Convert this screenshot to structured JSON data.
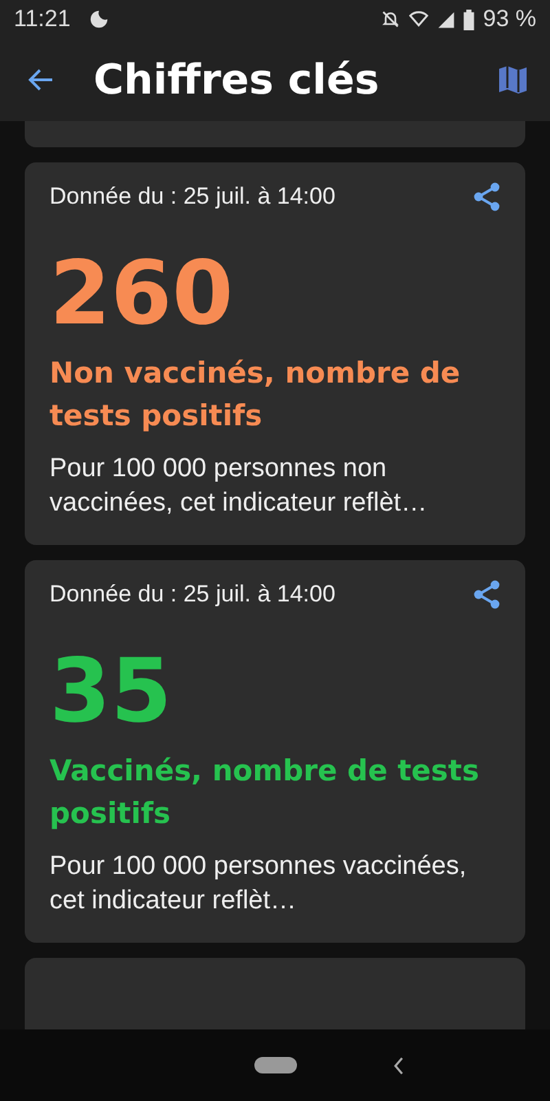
{
  "status_bar": {
    "time": "11:21",
    "battery": "93 %"
  },
  "app_bar": {
    "title": "Chiffres clés"
  },
  "cards": [
    {
      "date": "Donnée du : 25 juil. à 14:00",
      "value": "260",
      "color": "#f78b53",
      "title": "Non vaccinés, nombre de tests positifs",
      "description": "Pour 100 000 personnes non vaccinées, cet indicateur reflèt…"
    },
    {
      "date": "Donnée du : 25 juil. à 14:00",
      "value": "35",
      "color": "#26c24f",
      "title": "Vaccinés, nombre de tests positifs",
      "description": "Pour 100 000 personnes vaccinées, cet indicateur reflèt…"
    }
  ]
}
